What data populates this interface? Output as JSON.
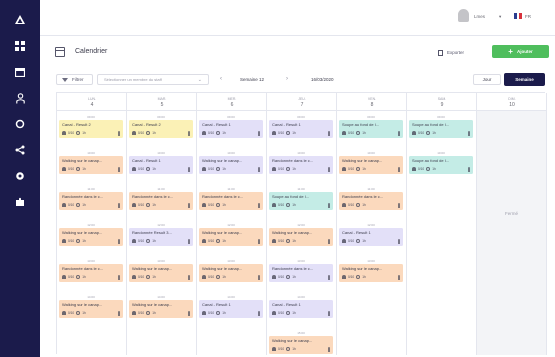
{
  "colors": {
    "sidebar": "#1b1b4b",
    "accent_green": "#4fbe5d",
    "card_yellow": "#fbf1b6",
    "card_orange": "#fbd9bd",
    "card_lavender": "#e3e0f8",
    "card_teal": "#c4ece6"
  },
  "sidebar": {
    "items": [
      {
        "icon": "logo-icon"
      },
      {
        "icon": "dashboard-icon"
      },
      {
        "icon": "calendar-icon"
      },
      {
        "icon": "users-icon"
      },
      {
        "icon": "refresh-icon"
      },
      {
        "icon": "share-icon"
      },
      {
        "icon": "gear-icon"
      },
      {
        "icon": "puzzle-icon"
      }
    ]
  },
  "topbar": {
    "user_name": "Lmes",
    "user_caret": "▾",
    "language": "FR"
  },
  "page": {
    "title": "Calendrier",
    "export_label": "Exporter",
    "add_label": "Ajouter"
  },
  "toolbar": {
    "filter_label": "Filtrer",
    "search_placeholder": "Sélectionner un membre du staff",
    "week_label": "Semaine 12",
    "date_range": "16/03/2020",
    "view_day": "Jour",
    "view_week": "Semaine"
  },
  "closed_label": "Fermé",
  "days": [
    {
      "name": "LUN.",
      "num": "4",
      "slots": [
        {
          "time": "09:00",
          "title": "Canal - Result 2",
          "people": "0/10",
          "duration": "1h",
          "color": "yellow"
        },
        {
          "time": "10:00",
          "title": "Walking sur le canap...",
          "people": "0/10",
          "duration": "1h",
          "color": "orange"
        },
        {
          "time": "11:00",
          "title": "Randonnée dans le c...",
          "people": "0/10",
          "duration": "1h",
          "color": "orange"
        },
        {
          "time": "12:00",
          "title": "Walking sur le canap...",
          "people": "0/10",
          "duration": "1h",
          "color": "orange"
        },
        {
          "time": "13:00",
          "title": "Randonnée dans le c...",
          "people": "0/10",
          "duration": "1h",
          "color": "orange"
        },
        {
          "time": "14:00",
          "title": "Walking sur le canap...",
          "people": "0/10",
          "duration": "1h",
          "color": "orange"
        }
      ]
    },
    {
      "name": "MAR.",
      "num": "5",
      "slots": [
        {
          "time": "09:00",
          "title": "Canal - Result 2",
          "people": "0/10",
          "duration": "1h",
          "color": "yellow"
        },
        {
          "time": "10:00",
          "title": "Canal - Result 1",
          "people": "0/10",
          "duration": "1h",
          "color": "lavender"
        },
        {
          "time": "11:00",
          "title": "Randonnée dans le c...",
          "people": "0/10",
          "duration": "1h",
          "color": "orange"
        },
        {
          "time": "12:00",
          "title": "Randonnée Result 3...",
          "people": "0/10",
          "duration": "1h",
          "color": "lavender"
        },
        {
          "time": "13:00",
          "title": "Walking sur le canap...",
          "people": "0/10",
          "duration": "1h",
          "color": "orange"
        },
        {
          "time": "14:00",
          "title": "Walking sur le canap...",
          "people": "0/10",
          "duration": "1h",
          "color": "orange"
        }
      ]
    },
    {
      "name": "MER.",
      "num": "6",
      "slots": [
        {
          "time": "09:00",
          "title": "Canal - Result 1",
          "people": "0/10",
          "duration": "1h",
          "color": "lavender"
        },
        {
          "time": "10:00",
          "title": "Walking sur le canap...",
          "people": "0/10",
          "duration": "1h",
          "color": "lavender"
        },
        {
          "time": "11:00",
          "title": "Randonnée dans le c...",
          "people": "0/10",
          "duration": "1h",
          "color": "orange"
        },
        {
          "time": "12:00",
          "title": "Walking sur le canap...",
          "people": "0/10",
          "duration": "1h",
          "color": "orange"
        },
        {
          "time": "13:00",
          "title": "Walking sur le canap...",
          "people": "0/10",
          "duration": "1h",
          "color": "orange"
        },
        {
          "time": "14:00",
          "title": "Canal - Result 1",
          "people": "0/10",
          "duration": "1h",
          "color": "lavender"
        }
      ]
    },
    {
      "name": "JEU.",
      "num": "7",
      "slots": [
        {
          "time": "09:00",
          "title": "Canal - Result 1",
          "people": "0/10",
          "duration": "1h",
          "color": "lavender"
        },
        {
          "time": "10:00",
          "title": "Randonnée dans le c...",
          "people": "0/10",
          "duration": "1h",
          "color": "lavender"
        },
        {
          "time": "11:00",
          "title": "Soupe au fond de l...",
          "people": "0/10",
          "duration": "1h",
          "color": "teal"
        },
        {
          "time": "12:00",
          "title": "Walking sur le canap...",
          "people": "0/10",
          "duration": "1h",
          "color": "orange"
        },
        {
          "time": "13:00",
          "title": "Randonnée dans le c...",
          "people": "0/10",
          "duration": "1h",
          "color": "lavender"
        },
        {
          "time": "14:00",
          "title": "Canal - Result 1",
          "people": "0/10",
          "duration": "1h",
          "color": "lavender"
        },
        {
          "time": "15:00",
          "title": "Walking sur le canap...",
          "people": "0/10",
          "duration": "1h",
          "color": "orange"
        }
      ]
    },
    {
      "name": "VEN.",
      "num": "8",
      "slots": [
        {
          "time": "09:00",
          "title": "Soupe au fond de l...",
          "people": "0/10",
          "duration": "1h",
          "color": "teal"
        },
        {
          "time": "10:00",
          "title": "Walking sur le canap...",
          "people": "0/10",
          "duration": "1h",
          "color": "orange"
        },
        {
          "time": "11:00",
          "title": "Randonnée dans le c...",
          "people": "0/10",
          "duration": "1h",
          "color": "orange"
        },
        {
          "time": "12:00",
          "title": "Canal - Result 1",
          "people": "0/10",
          "duration": "1h",
          "color": "lavender"
        },
        {
          "time": "13:00",
          "title": "Walking sur le canap...",
          "people": "0/10",
          "duration": "1h",
          "color": "orange"
        }
      ]
    },
    {
      "name": "SAM.",
      "num": "9",
      "slots": [
        {
          "time": "09:00",
          "title": "Soupe au fond de l...",
          "people": "0/10",
          "duration": "1h",
          "color": "teal"
        },
        {
          "time": "10:00",
          "title": "Soupe au fond de l...",
          "people": "0/10",
          "duration": "1h",
          "color": "teal"
        }
      ]
    },
    {
      "name": "DIM.",
      "num": "10",
      "slots": []
    }
  ]
}
